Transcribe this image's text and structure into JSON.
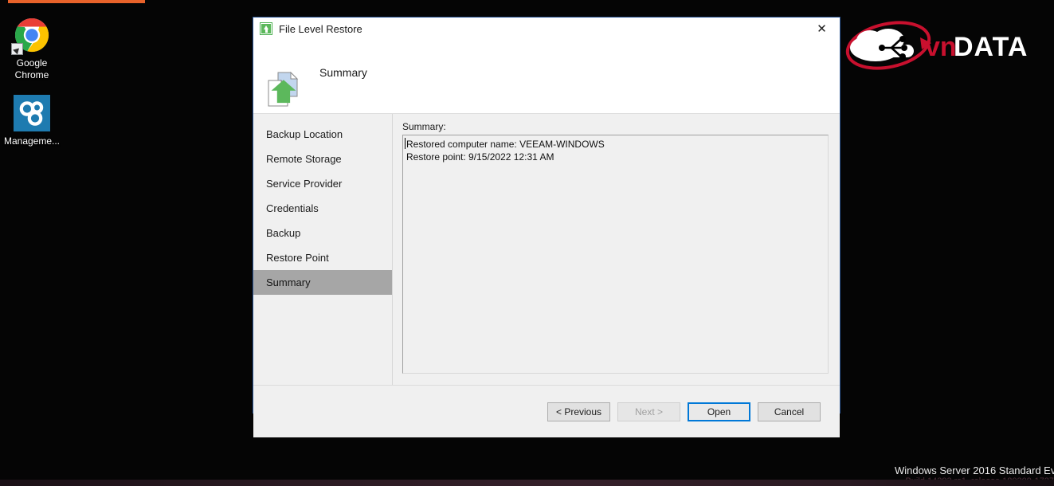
{
  "desktop": {
    "icons": [
      {
        "name": "chrome",
        "label": "Google\nChrome",
        "label_line1": "Google",
        "label_line2": "Chrome",
        "icon": "chrome-icon",
        "has_shortcut_arrow": true
      },
      {
        "name": "management",
        "label": "Manageme...",
        "icon": "management-icon",
        "has_shortcut_arrow": false
      }
    ],
    "watermark_line1": "Windows Server 2016 Standard Ev",
    "watermark_line2": "Build 14393.rs1_release.180209-1727",
    "accent_bar_color": "#e8622a"
  },
  "branding": {
    "logo_text_part1": "vn",
    "logo_text_part2": "DATA",
    "logo_icon": "cloud-circuit-icon",
    "color_red": "#c8102e",
    "color_white": "#ffffff"
  },
  "dialog": {
    "titlebar": {
      "icon": "file-level-restore-icon",
      "title": "File Level Restore",
      "close_label": "✕"
    },
    "header": {
      "icon": "document-restore-icon",
      "title": "Summary"
    },
    "sidebar": {
      "items": [
        {
          "label": "Backup Location",
          "active": false
        },
        {
          "label": "Remote Storage",
          "active": false
        },
        {
          "label": "Service Provider",
          "active": false
        },
        {
          "label": "Credentials",
          "active": false
        },
        {
          "label": "Backup",
          "active": false
        },
        {
          "label": "Restore Point",
          "active": false
        },
        {
          "label": "Summary",
          "active": true
        }
      ],
      "selected_bg": "#a6a6a6"
    },
    "content": {
      "summary_label": "Summary:",
      "summary_lines": [
        "Restored computer name: VEEAM-WINDOWS",
        "Restore point: 9/15/2022 12:31 AM"
      ]
    },
    "footer": {
      "buttons": [
        {
          "label": "< Previous",
          "state": "enabled"
        },
        {
          "label": "Next >",
          "state": "disabled"
        },
        {
          "label": "Open",
          "state": "focused"
        },
        {
          "label": "Cancel",
          "state": "enabled"
        }
      ],
      "focus_color": "#0078d7"
    }
  }
}
